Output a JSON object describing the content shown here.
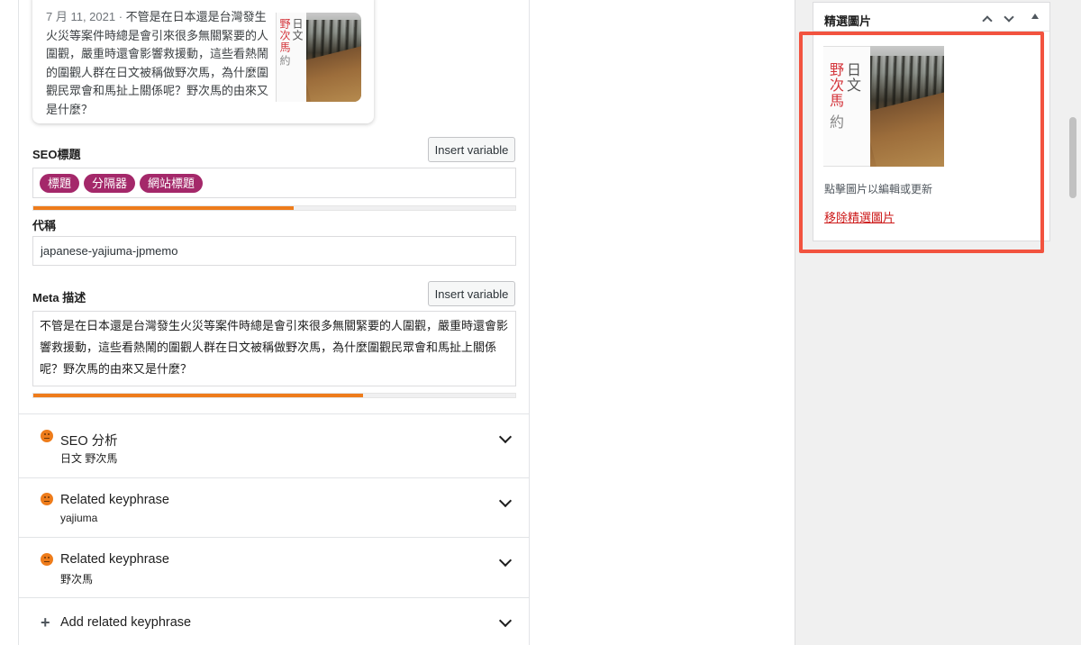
{
  "snippet_preview": {
    "date": "7 月 11, 2021 · ",
    "description": "不管是在日本還是台灣發生火災等案件時總是會引來很多無關緊要的人圍觀，嚴重時還會影響救援動，這些看熱鬧的圍觀人群在日文被稱做野次馬，為什麼圍觀民眾會和馬扯上關係呢？野次馬的由來又是什麼？",
    "thumb_text_red": "野次馬",
    "thumb_text_gray_1": "日文",
    "thumb_text_gray_2": "約"
  },
  "seo_title": {
    "label": "SEO標題",
    "insert_label": "Insert variable",
    "pills": [
      "標題",
      "分隔器",
      "網站標題"
    ],
    "progress_fraction": 0.54
  },
  "slug": {
    "label": "代稱",
    "value": "japanese-yajiuma-jpmemo"
  },
  "meta_description": {
    "label": "Meta 描述",
    "insert_label": "Insert variable",
    "value": "不管是在日本還是台灣發生火災等案件時總是會引來很多無關緊要的人圍觀，嚴重時還會影響救援動，這些看熱鬧的圍觀人群在日文被稱做野次馬，為什麼圍觀民眾會和馬扯上關係呢？野次馬的由來又是什麼？",
    "progress_fraction": 0.685
  },
  "accordions": [
    {
      "title": "SEO 分析",
      "subtitle": "日文 野次馬"
    },
    {
      "title": "Related keyphrase",
      "subtitle": "yajiuma"
    },
    {
      "title": "Related keyphrase",
      "subtitle": "野次馬"
    },
    {
      "title": "Add related keyphrase",
      "subtitle": ""
    }
  ],
  "featured_image": {
    "panel_title": "精選圖片",
    "hint": "點擊圖片以編輯或更新",
    "remove_link": "移除精選圖片",
    "img_text_red": "野次馬",
    "img_text_gray_1": "日文",
    "img_text_gray_2": "約"
  },
  "colors": {
    "accent_pill": "#a4286a",
    "progress_orange": "#ee7c1b",
    "highlight_red": "#f2533f",
    "link_red": "#cc1818"
  },
  "icons": {
    "accordion_status": "neutral-face-icon",
    "accordion_toggle": "chevron-down-icon",
    "add": "plus-icon"
  }
}
